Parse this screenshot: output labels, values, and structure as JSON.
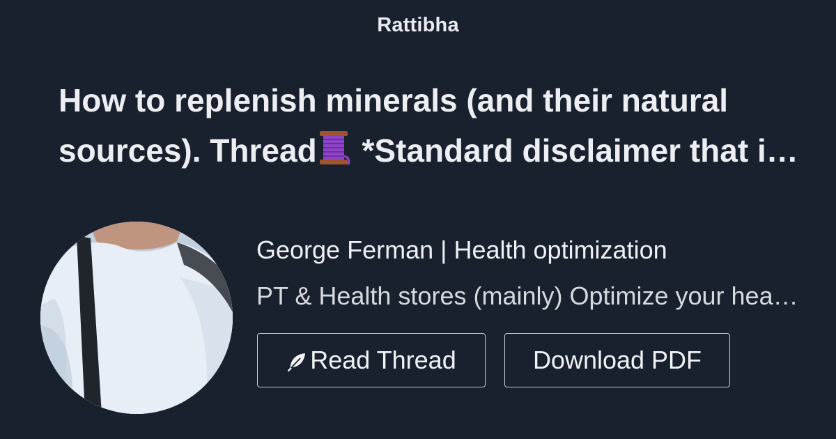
{
  "site": {
    "name": "Rattibha"
  },
  "thread": {
    "title_line1": "How to replenish minerals (and their natural",
    "title_line2_before_emoji": "sources). Thread",
    "title_emoji": "spool-of-thread-emoji",
    "title_line2_after_emoji": " *Standard disclaimer that if you're deficient consult a doctor*"
  },
  "author": {
    "name": "George Ferman | Health optimization",
    "bio": "PT & Health stores (mainly) Optimize your health naturally",
    "avatar": "author-photo"
  },
  "actions": {
    "read_label": "Read Thread",
    "read_icon": "feather-icon",
    "pdf_label": "Download PDF"
  },
  "colors": {
    "background": "#19212e",
    "text": "#eef0f3",
    "button_border": "#c9ccd2"
  }
}
